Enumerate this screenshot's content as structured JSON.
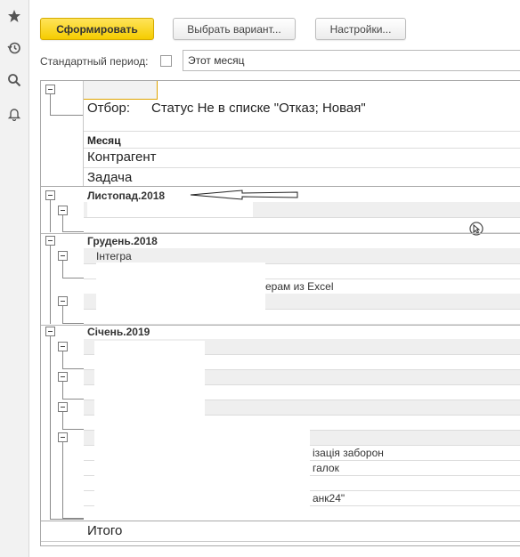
{
  "toolbar": {
    "generate": "Сформировать",
    "choose_variant": "Выбрать вариант...",
    "settings": "Настройки..."
  },
  "period": {
    "label": "Стандартный период:",
    "value": "Этот месяц"
  },
  "report": {
    "filter_label": "Отбор:",
    "filter_value": "Статус Не в списке \"Отказ; Новая\"",
    "grouping": [
      "Месяц",
      "Контрагент",
      "Задача"
    ],
    "months": [
      {
        "name": "Листопад.2018"
      },
      {
        "name": "Грудень.2018",
        "counterparty": "Інтегра",
        "task_fragment": "ерам из Excel"
      },
      {
        "name": "Січень.2019",
        "fragments": [
          "ізація заборон",
          "галок",
          "анк24\""
        ]
      }
    ],
    "total": "Итого"
  },
  "icons": [
    "star-icon",
    "history-icon",
    "search-icon",
    "bell-icon",
    "cursor-icon",
    "arrow-annotation"
  ]
}
